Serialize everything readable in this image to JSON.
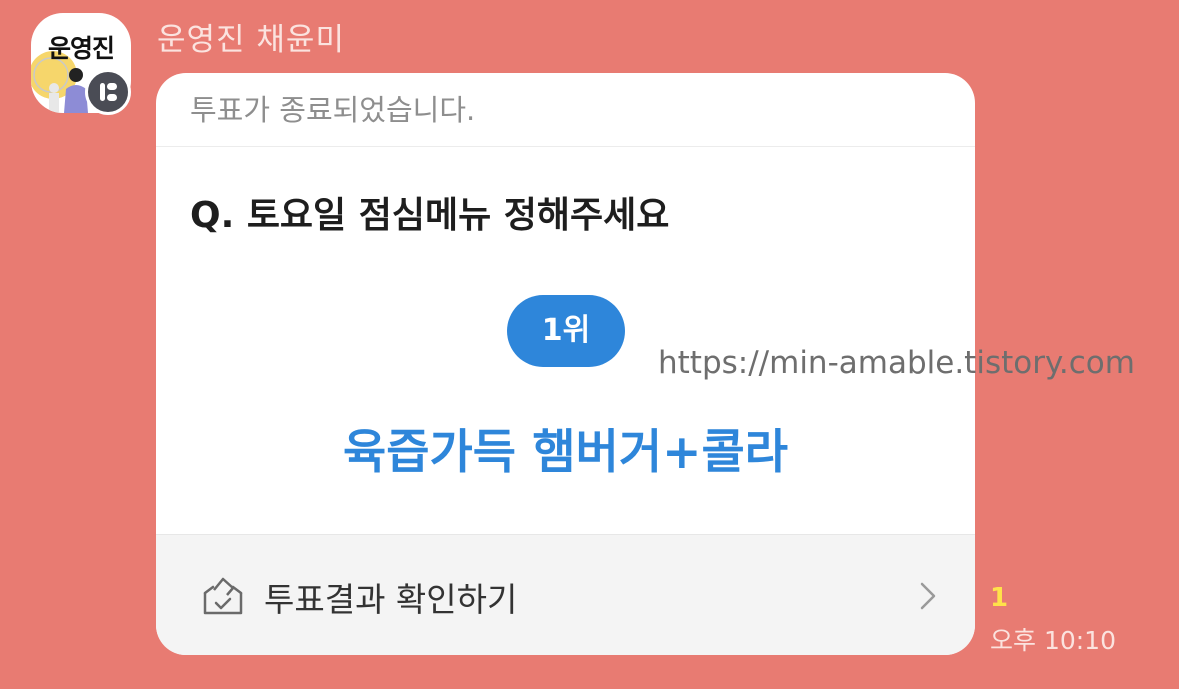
{
  "chat": {
    "sender_name": "운영진 채윤미",
    "avatar_label": "운영진",
    "time": "오후 10:10",
    "unread_count": "1"
  },
  "poll": {
    "status": "투표가 종료되었습니다.",
    "question": "Q. 토요일 점심메뉴 정해주세요",
    "rank_label": "1위",
    "top_result": "육즙가득 햄버거+콜라",
    "view_results_label": "투표결과 확인하기"
  },
  "watermark": "https://min-amable.tistory.com",
  "colors": {
    "chat_background": "#E87B72",
    "accent": "#2E86DA",
    "unread": "#FFE24A"
  },
  "icons": {
    "avatar_badge": "channel-badge-icon",
    "footer": "ballot-box-check-icon",
    "chevron": "chevron-right-icon"
  }
}
